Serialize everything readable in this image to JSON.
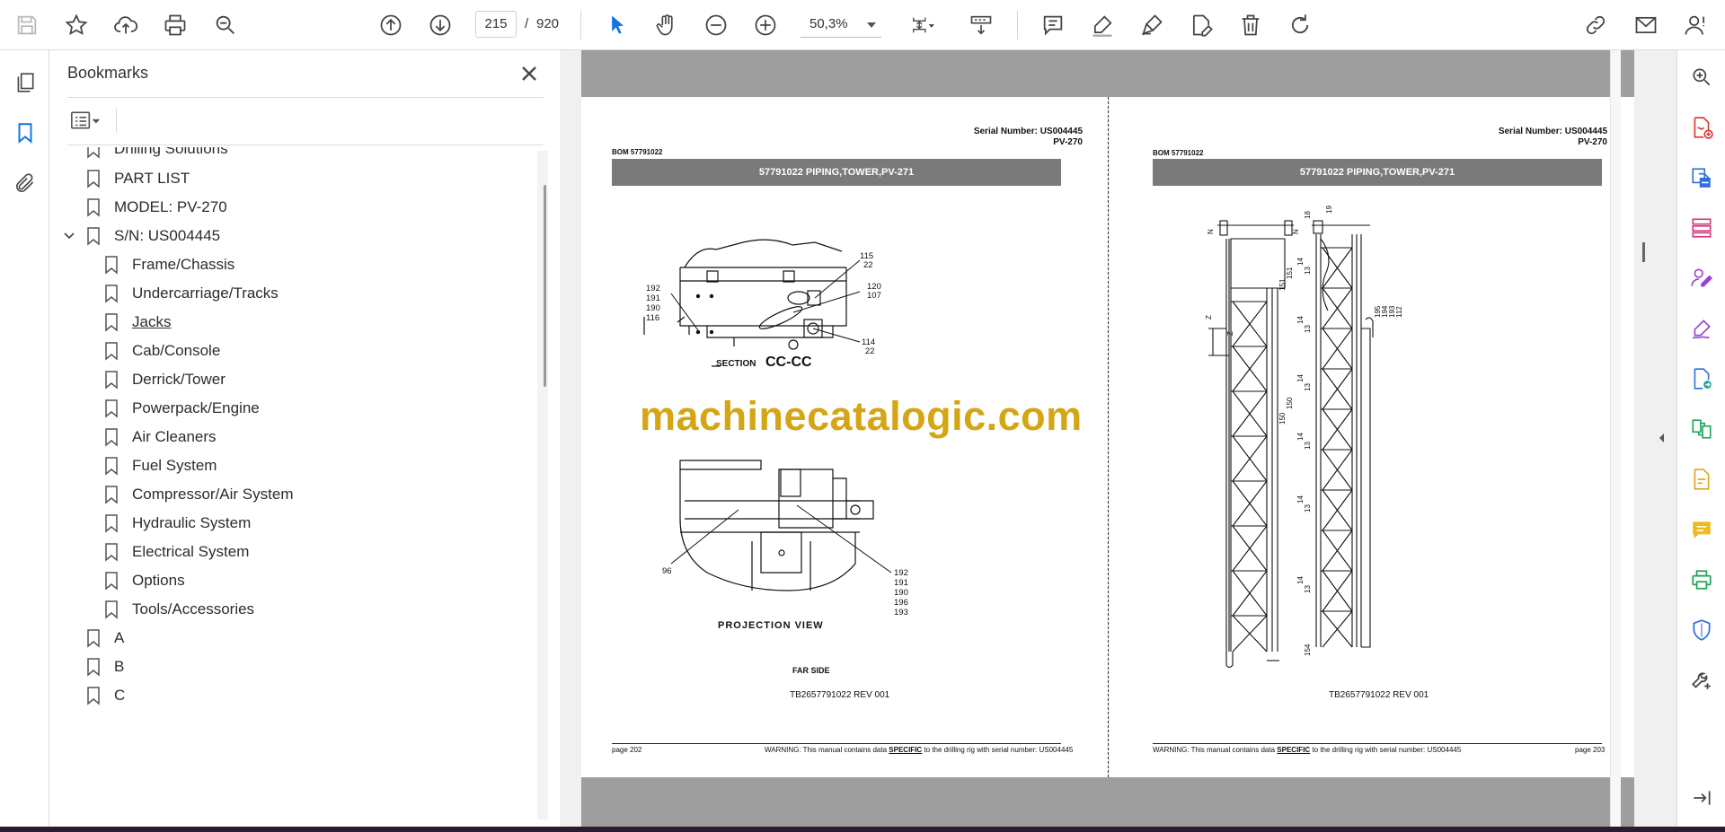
{
  "toolbar": {
    "page_current": "215",
    "page_separator": "/",
    "page_total": "920",
    "zoom": "50,3%"
  },
  "bookmarks": {
    "title": "Bookmarks",
    "items": [
      {
        "label": "Drilling Solutions",
        "level": 1
      },
      {
        "label": "PART LIST",
        "level": 1
      },
      {
        "label": "MODEL: PV-270",
        "level": 1
      },
      {
        "label": "S/N: US004445",
        "level": 1,
        "expanded": true
      },
      {
        "label": "Frame/Chassis",
        "level": 2
      },
      {
        "label": "Undercarriage/Tracks",
        "level": 2
      },
      {
        "label": "Jacks",
        "level": 2,
        "hover": true
      },
      {
        "label": "Cab/Console",
        "level": 2
      },
      {
        "label": "Derrick/Tower",
        "level": 2
      },
      {
        "label": "Powerpack/Engine",
        "level": 2
      },
      {
        "label": "Air Cleaners",
        "level": 2
      },
      {
        "label": "Fuel System",
        "level": 2
      },
      {
        "label": "Compressor/Air System",
        "level": 2
      },
      {
        "label": "Hydraulic System",
        "level": 2
      },
      {
        "label": "Electrical System",
        "level": 2
      },
      {
        "label": "Options",
        "level": 2
      },
      {
        "label": "Tools/Accessories",
        "level": 2
      },
      {
        "label": "A",
        "level": 1
      },
      {
        "label": "B",
        "level": 1
      },
      {
        "label": "C",
        "level": 1
      }
    ]
  },
  "document": {
    "left_page": {
      "serial_line1": "Serial Number: US004445",
      "serial_line2": "PV-270",
      "bom": "BOM 57791022",
      "banner": "57791022 PIPING,TOWER,PV-271",
      "section_label": "SECTION",
      "section_name": "CC-CC",
      "projection_label": "PROJECTION VIEW",
      "far_side": "FAR SIDE",
      "doc_number": "TB2657791022 REV 001",
      "page_label": "page 202",
      "warning_pre": "WARNING:  This manual contains data",
      "warning_specific": "SPECIFIC",
      "warning_post": "to the drilling rig with serial number: US004445",
      "callouts": {
        "a115": "115",
        "a22a": "22",
        "a120": "120",
        "a107": "107",
        "a192": "192",
        "a191": "191",
        "a190": "190",
        "a116": "116",
        "a114": "114",
        "a22b": "22",
        "b96": "96",
        "b192": "192",
        "b191": "191",
        "b190": "190",
        "b196": "196",
        "b193": "193"
      }
    },
    "right_page": {
      "serial_line1": "Serial Number: US004445",
      "serial_line2": "PV-270",
      "bom": "BOM 57791022",
      "banner": "57791022 PIPING,TOWER,PV-271",
      "doc_number": "TB2657791022 REV 001",
      "page_label": "page 203",
      "warning_pre": "WARNING:  This manual contains data",
      "warning_specific": "SPECIFIC",
      "warning_post": "to the drilling rig with serial number: US004445"
    },
    "watermark": "machinecatalogic.com"
  },
  "colors": {
    "accent_blue": "#1473e6",
    "banner_gray": "#7a7a7a",
    "watermark": "#d4a514"
  }
}
